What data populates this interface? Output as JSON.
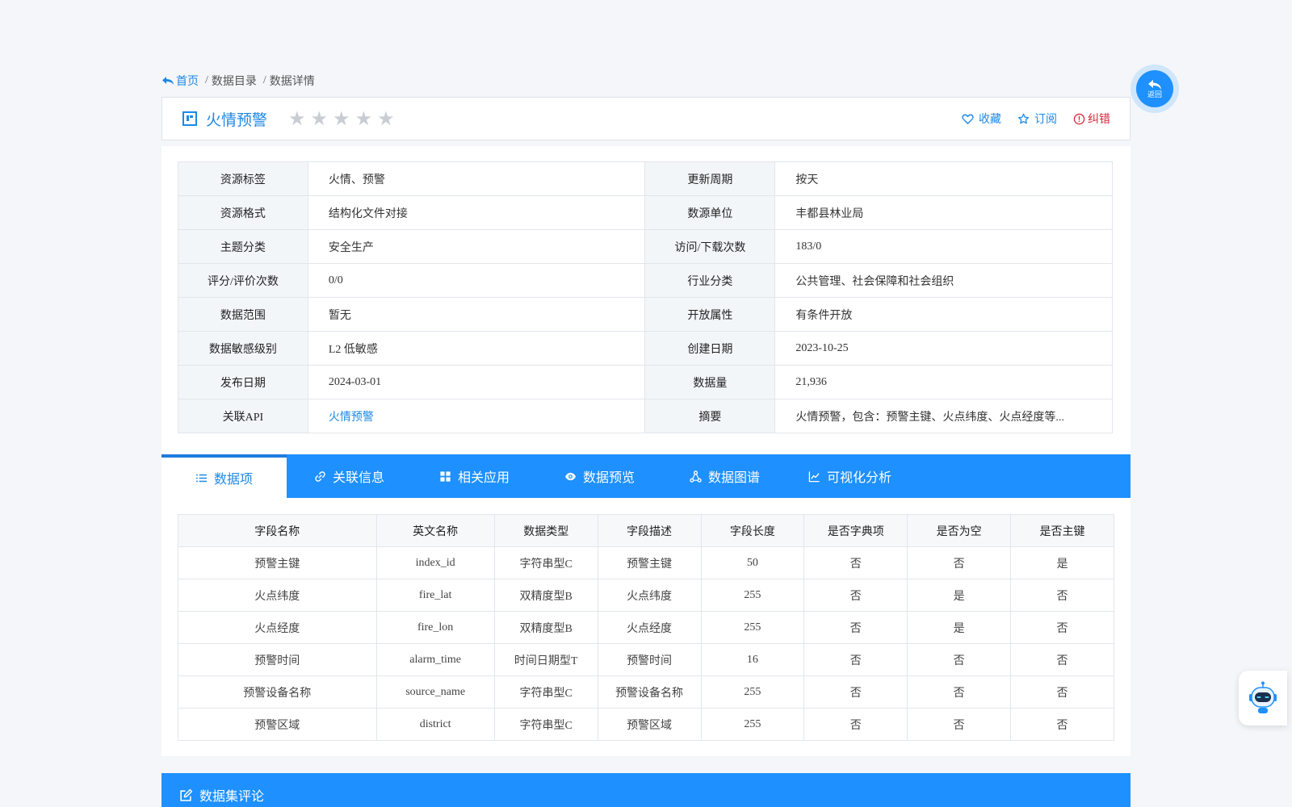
{
  "breadcrumb": {
    "home": "首页",
    "items": [
      "数据目录",
      "数据详情"
    ]
  },
  "title": {
    "text": "火情预警",
    "stars": [
      "★",
      "★",
      "★",
      "★",
      "★"
    ]
  },
  "actions": {
    "favorite": "收藏",
    "subscribe": "订阅",
    "report": "纠错"
  },
  "info": [
    {
      "k1": "资源标签",
      "v1": "火情、预警",
      "k2": "更新周期",
      "v2": "按天"
    },
    {
      "k1": "资源格式",
      "v1": "结构化文件对接",
      "k2": "数源单位",
      "v2": "丰都县林业局"
    },
    {
      "k1": "主题分类",
      "v1": "安全生产",
      "k2": "访问/下载次数",
      "v2": "183/0"
    },
    {
      "k1": "评分/评价次数",
      "v1": "0/0",
      "k2": "行业分类",
      "v2": "公共管理、社会保障和社会组织"
    },
    {
      "k1": "数据范围",
      "v1": "暂无",
      "k2": "开放属性",
      "v2": "有条件开放"
    },
    {
      "k1": "数据敏感级别",
      "v1": "L2 低敏感",
      "k2": "创建日期",
      "v2": "2023-10-25"
    },
    {
      "k1": "发布日期",
      "v1": "2024-03-01",
      "k2": "数据量",
      "v2": "21,936"
    },
    {
      "k1": "关联API",
      "v1": "火情预警",
      "k2": "摘要",
      "v2": "火情预警，包含：预警主键、火点纬度、火点经度等..."
    }
  ],
  "tabs": [
    "数据项",
    "关联信息",
    "相关应用",
    "数据预览",
    "数据图谱",
    "可视化分析"
  ],
  "fields": {
    "headers": [
      "字段名称",
      "英文名称",
      "数据类型",
      "字段描述",
      "字段长度",
      "是否字典项",
      "是否为空",
      "是否主键"
    ],
    "rows": [
      [
        "预警主键",
        "index_id",
        "字符串型C",
        "预警主键",
        "50",
        "否",
        "否",
        "是"
      ],
      [
        "火点纬度",
        "fire_lat",
        "双精度型B",
        "火点纬度",
        "255",
        "否",
        "是",
        "否"
      ],
      [
        "火点经度",
        "fire_lon",
        "双精度型B",
        "火点经度",
        "255",
        "否",
        "是",
        "否"
      ],
      [
        "预警时间",
        "alarm_time",
        "时间日期型T",
        "预警时间",
        "16",
        "否",
        "否",
        "否"
      ],
      [
        "预警设备名称",
        "source_name",
        "字符串型C",
        "预警设备名称",
        "255",
        "否",
        "否",
        "否"
      ],
      [
        "预警区域",
        "district",
        "字符串型C",
        "预警区域",
        "255",
        "否",
        "否",
        "否"
      ]
    ]
  },
  "comment": {
    "title": "数据集评论"
  },
  "back": {
    "label": "返回"
  },
  "colors": {
    "primary": "#1e90ff",
    "link": "#1e88e5",
    "danger": "#d9263b",
    "star_inactive": "#c9cdd3"
  }
}
